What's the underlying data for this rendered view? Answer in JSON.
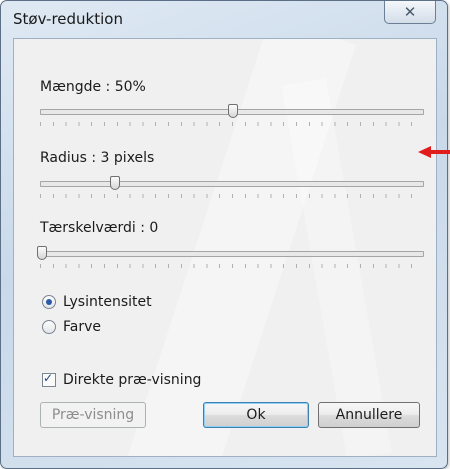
{
  "window": {
    "title": "Støv-reduktion",
    "close_glyph": "✕"
  },
  "sliders": [
    {
      "label": "Mængde : 50%",
      "value_fraction": 0.5
    },
    {
      "label": "Radius : 3 pixels",
      "value_fraction": 0.19
    },
    {
      "label": "Tærskelværdi : 0",
      "value_fraction": 0.0
    }
  ],
  "mode_options": [
    {
      "label": "Lysintensitet",
      "selected": true
    },
    {
      "label": "Farve",
      "selected": false
    }
  ],
  "preview_checkbox": {
    "label": "Direkte præ-visning",
    "checked": true
  },
  "buttons": {
    "preview": "Præ-visning",
    "ok": "Ok",
    "cancel": "Annullere"
  },
  "colors": {
    "accent_radio": "#2b58a8",
    "default_button_border": "#3c7fb1",
    "annotation_arrow": "#e11c1c"
  },
  "icons": {
    "close": "close-icon",
    "annotation": "red-arrow-icon"
  }
}
